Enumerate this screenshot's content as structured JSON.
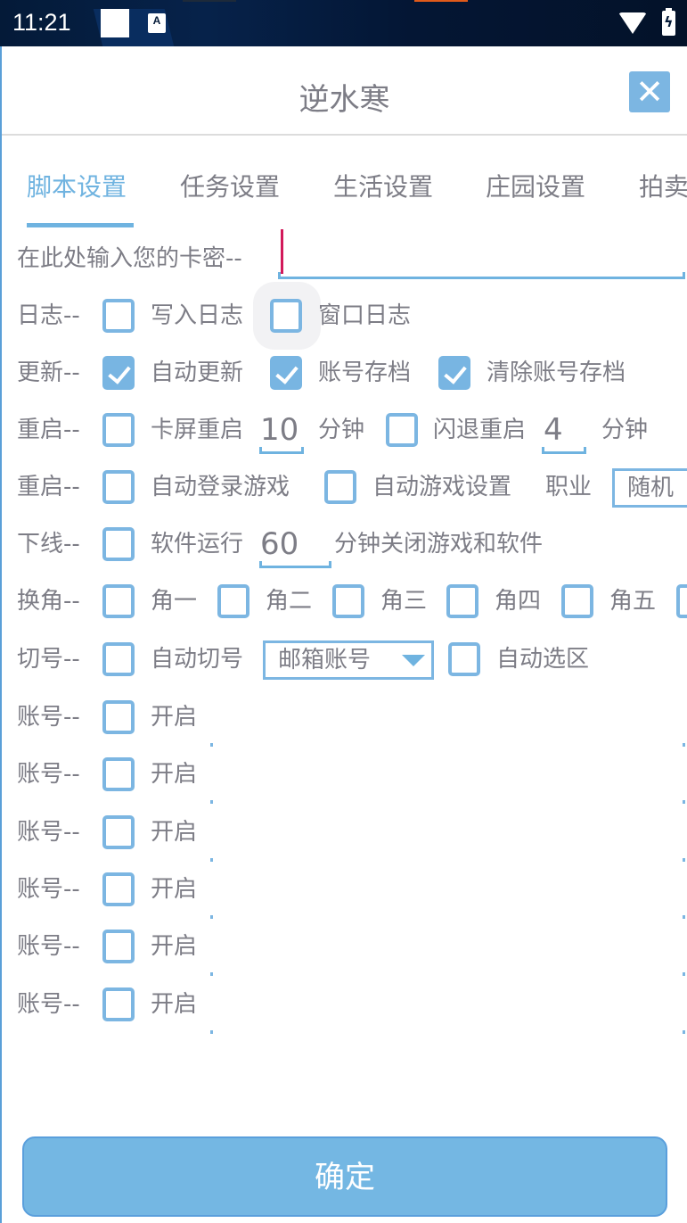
{
  "status_bar": {
    "time": "11:21",
    "icons": [
      "square-notification-icon",
      "a-accessibility-icon",
      "wifi-icon",
      "battery-charging-icon"
    ],
    "a_icon_glyph": "A",
    "battery_glyph": "ϟ"
  },
  "dialog": {
    "title": "逆水寒",
    "close_glyph": "✕",
    "tabs": [
      {
        "label": "脚本设置",
        "active": true
      },
      {
        "label": "任务设置",
        "active": false
      },
      {
        "label": "生活设置",
        "active": false
      },
      {
        "label": "庄园设置",
        "active": false
      },
      {
        "label": "拍卖",
        "active": false
      }
    ],
    "key": {
      "label": "在此处输入您的卡密--",
      "value": ""
    },
    "log": {
      "label": "日志--",
      "options": [
        {
          "label": "写入日志",
          "checked": false
        },
        {
          "label": "窗口日志",
          "checked": false
        }
      ]
    },
    "update": {
      "label": "更新--",
      "options": [
        {
          "label": "自动更新",
          "checked": true
        },
        {
          "label": "账号存档",
          "checked": true
        },
        {
          "label": "清除账号存档",
          "checked": true
        }
      ]
    },
    "restart1": {
      "label": "重启--",
      "freeze": {
        "label": "卡屏重启",
        "checked": false,
        "value": "10",
        "unit": "分钟"
      },
      "crash": {
        "label": "闪退重启",
        "checked": false,
        "value": "4",
        "unit": "分钟"
      }
    },
    "restart2": {
      "label": "重启--",
      "auto_login": {
        "label": "自动登录游戏",
        "checked": false
      },
      "auto_setting": {
        "label": "自动游戏设置",
        "checked": false
      },
      "job_label": "职业",
      "job_value": "随机"
    },
    "offline": {
      "label": "下线--",
      "prefix": "软件运行",
      "checked": false,
      "value": "60",
      "suffix": "分钟关闭游戏和软件"
    },
    "switch_role": {
      "label": "换角--",
      "options": [
        {
          "label": "角一",
          "checked": false
        },
        {
          "label": "角二",
          "checked": false
        },
        {
          "label": "角三",
          "checked": false
        },
        {
          "label": "角四",
          "checked": false
        },
        {
          "label": "角五",
          "checked": false
        },
        {
          "label": "",
          "checked": false
        }
      ]
    },
    "switch_account": {
      "label": "切号--",
      "auto_switch": {
        "label": "自动切号",
        "checked": false
      },
      "account_type": "邮箱账号",
      "auto_server": {
        "label": "自动选区",
        "checked": false
      }
    },
    "accounts": [
      {
        "label": "账号--",
        "option": "开启",
        "checked": false,
        "value": ""
      },
      {
        "label": "账号--",
        "option": "开启",
        "checked": false,
        "value": ""
      },
      {
        "label": "账号--",
        "option": "开启",
        "checked": false,
        "value": ""
      },
      {
        "label": "账号--",
        "option": "开启",
        "checked": false,
        "value": ""
      },
      {
        "label": "账号--",
        "option": "开启",
        "checked": false,
        "value": ""
      },
      {
        "label": "账号--",
        "option": "开启",
        "checked": false,
        "value": ""
      }
    ],
    "confirm_label": "确定"
  },
  "colors": {
    "accent": "#6fb3e0",
    "checkbox": "#7cb6e2",
    "text": "#7d7d86",
    "status_bar": "#041a38",
    "cursor": "#d21a5a",
    "button": "#74b7e3"
  }
}
